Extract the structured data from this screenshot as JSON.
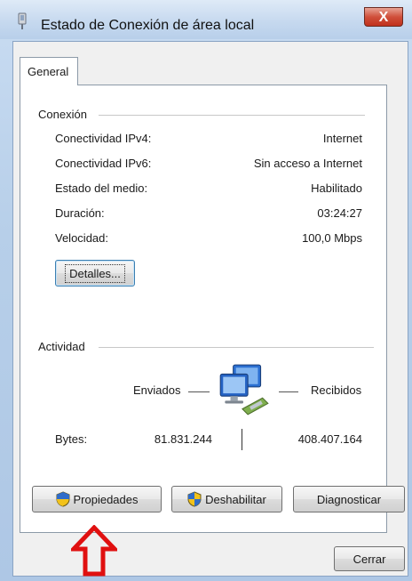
{
  "window": {
    "title": "Estado de Conexión de área local",
    "close_glyph": "X"
  },
  "tabs": [
    {
      "label": "General"
    }
  ],
  "conexion": {
    "heading": "Conexión",
    "rows": [
      {
        "label": "Conectividad IPv4:",
        "value": "Internet"
      },
      {
        "label": "Conectividad IPv6:",
        "value": "Sin acceso a Internet"
      },
      {
        "label": "Estado del medio:",
        "value": "Habilitado"
      },
      {
        "label": "Duración:",
        "value": "03:24:27"
      },
      {
        "label": "Velocidad:",
        "value": "100,0 Mbps"
      }
    ],
    "details_button": "Detalles..."
  },
  "actividad": {
    "heading": "Actividad",
    "sent_label": "Enviados",
    "received_label": "Recibidos",
    "bytes_label": "Bytes:",
    "bytes_sent": "81.831.244",
    "bytes_received": "408.407.164"
  },
  "buttons": {
    "properties": "Propiedades",
    "disable": "Deshabilitar",
    "diagnose": "Diagnosticar",
    "close": "Cerrar"
  },
  "icons": {
    "title": "network-connection-icon",
    "activity": "network-computers-icon",
    "shield": "uac-shield-icon",
    "annotation": "red-up-arrow"
  },
  "colors": {
    "close_button": "#c0301c",
    "arrow": "#e01010",
    "titlebar": "#c6d9ef"
  }
}
